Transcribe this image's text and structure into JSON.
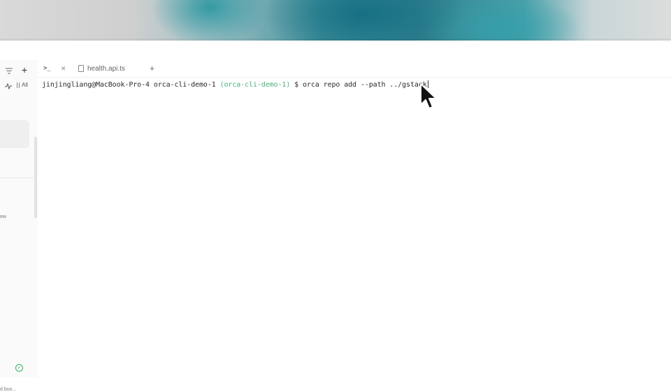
{
  "sidebar": {
    "filter_label": "All",
    "section_hint": "ew",
    "status_text": "d bun..."
  },
  "tabs": [
    {
      "label": "",
      "icon": "terminal-icon"
    },
    {
      "label": "health.api.ts",
      "icon": "file-icon"
    }
  ],
  "terminal": {
    "prompt_user": "jinjingliang@MacBook-Pro-4 orca-cli-demo-1 ",
    "prompt_env": "(orca-cli-demo-1)",
    "prompt_symbol": " $ ",
    "command": "orca repo add --path ../gstack"
  },
  "colors": {
    "env_green": "#4caf7a",
    "status_green": "#37b26c"
  }
}
